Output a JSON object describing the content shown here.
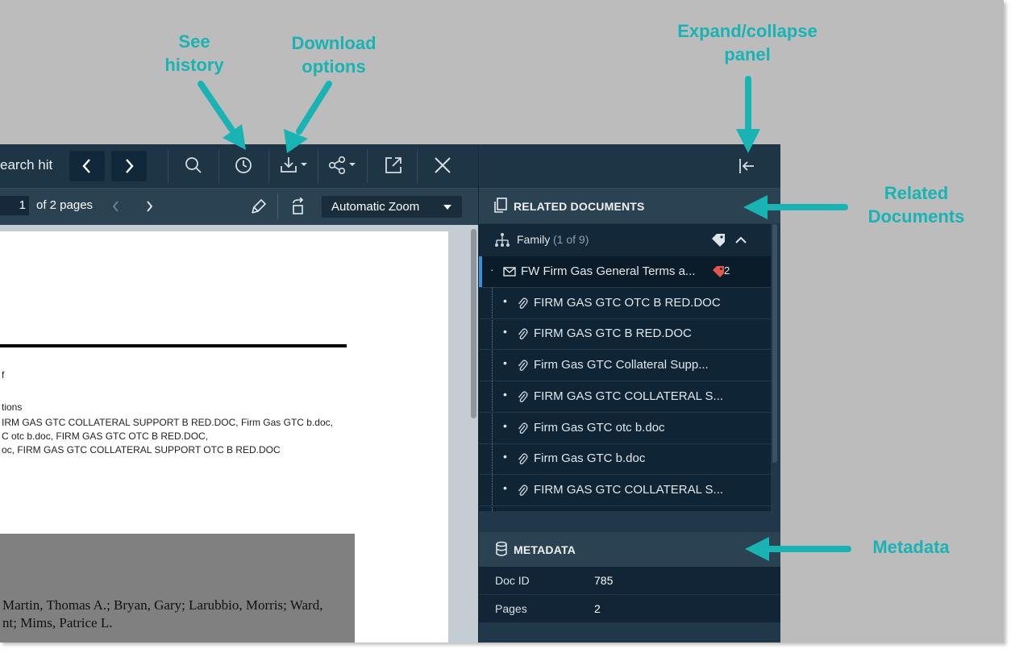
{
  "callouts": {
    "see_history": "See history",
    "download": "Download options",
    "expand": "Expand/collapse panel",
    "related": "Related Documents",
    "metadata": "Metadata"
  },
  "toolbar": {
    "search_hit": "earch hit",
    "prev": "‹",
    "next": "›"
  },
  "subbar": {
    "page_current": "1",
    "of_pages": "of 2 pages",
    "zoom": "Automatic Zoom"
  },
  "document": {
    "line1": "f",
    "line2": "tions",
    "line3": "IRM GAS GTC COLLATERAL SUPPORT B RED.DOC, Firm Gas GTC b.doc,",
    "line4": "C otc b.doc, FIRM GAS GTC OTC B RED.DOC,",
    "line5": "oc, FIRM GAS GTC COLLATERAL SUPPORT OTC B RED.DOC",
    "names1": "Martin, Thomas A.; Bryan, Gary; Larubbio, Morris; Ward,",
    "names2": "nt; Mims, Patrice L."
  },
  "panel": {
    "related_title": "RELATED DOCUMENTS",
    "family_label": "Family",
    "family_count": "(1 of 9)",
    "email_item": "FW Firm Gas General Terms a...",
    "tag_count": "2",
    "attachments": [
      "FIRM GAS GTC OTC B RED.DOC",
      "FIRM GAS GTC B RED.DOC",
      "Firm Gas GTC Collateral Supp...",
      "FIRM GAS GTC COLLATERAL S...",
      "Firm Gas GTC otc b.doc",
      "Firm Gas GTC b.doc",
      "FIRM GAS GTC COLLATERAL S..."
    ],
    "metadata_title": "METADATA",
    "meta": [
      {
        "key": "Doc ID",
        "value": "785"
      },
      {
        "key": "Pages",
        "value": "2"
      }
    ]
  },
  "colors": {
    "accent": "#19b3b3",
    "tag": "#e2574c",
    "selected_bar": "#3a8fd6"
  },
  "icons": [
    "search-icon",
    "history-icon",
    "download-icon",
    "share-icon",
    "popout-icon",
    "close-icon",
    "collapse-panel-icon",
    "highlighter-icon",
    "rotate-icon",
    "documents-icon",
    "hierarchy-icon",
    "tag-icon",
    "chevron-up-icon",
    "envelope-icon",
    "paperclip-icon",
    "database-icon"
  ]
}
